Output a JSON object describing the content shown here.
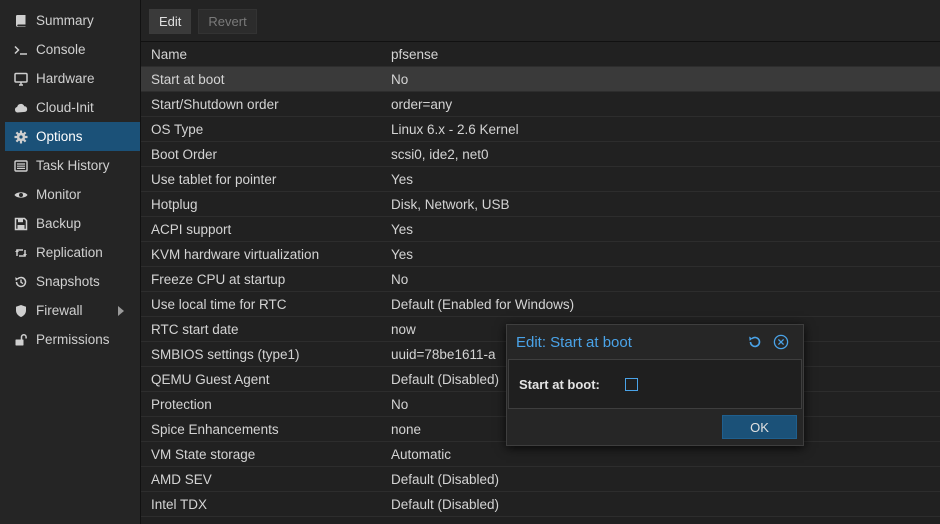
{
  "sidebar": {
    "items": [
      {
        "label": "Summary",
        "icon": "book-icon"
      },
      {
        "label": "Console",
        "icon": "terminal-icon"
      },
      {
        "label": "Hardware",
        "icon": "desktop-icon"
      },
      {
        "label": "Cloud-Init",
        "icon": "cloud-icon"
      },
      {
        "label": "Options",
        "icon": "gear-icon",
        "active": true
      },
      {
        "label": "Task History",
        "icon": "list-icon"
      },
      {
        "label": "Monitor",
        "icon": "eye-icon"
      },
      {
        "label": "Backup",
        "icon": "floppy-icon"
      },
      {
        "label": "Replication",
        "icon": "retweet-icon"
      },
      {
        "label": "Snapshots",
        "icon": "history-icon"
      },
      {
        "label": "Firewall",
        "icon": "shield-icon",
        "has_submenu": true
      },
      {
        "label": "Permissions",
        "icon": "unlock-icon"
      }
    ]
  },
  "toolbar": {
    "edit_label": "Edit",
    "revert_label": "Revert"
  },
  "options": {
    "rows": [
      {
        "name": "Name",
        "value": "pfsense"
      },
      {
        "name": "Start at boot",
        "value": "No",
        "selected": true
      },
      {
        "name": "Start/Shutdown order",
        "value": "order=any"
      },
      {
        "name": "OS Type",
        "value": "Linux 6.x - 2.6 Kernel"
      },
      {
        "name": "Boot Order",
        "value": "scsi0, ide2, net0"
      },
      {
        "name": "Use tablet for pointer",
        "value": "Yes"
      },
      {
        "name": "Hotplug",
        "value": "Disk, Network, USB"
      },
      {
        "name": "ACPI support",
        "value": "Yes"
      },
      {
        "name": "KVM hardware virtualization",
        "value": "Yes"
      },
      {
        "name": "Freeze CPU at startup",
        "value": "No"
      },
      {
        "name": "Use local time for RTC",
        "value": "Default (Enabled for Windows)"
      },
      {
        "name": "RTC start date",
        "value": "now"
      },
      {
        "name": "SMBIOS settings (type1)",
        "value": "uuid=78be1611-a"
      },
      {
        "name": "QEMU Guest Agent",
        "value": "Default (Disabled)"
      },
      {
        "name": "Protection",
        "value": "No"
      },
      {
        "name": "Spice Enhancements",
        "value": "none"
      },
      {
        "name": "VM State storage",
        "value": "Automatic"
      },
      {
        "name": "AMD SEV",
        "value": "Default (Disabled)"
      },
      {
        "name": "Intel TDX",
        "value": "Default (Disabled)"
      }
    ]
  },
  "dialog": {
    "title": "Edit: Start at boot",
    "field_label": "Start at boot:",
    "checked": false,
    "ok_label": "OK",
    "reset_icon": "undo-icon",
    "close_icon": "close-circle-icon"
  },
  "colors": {
    "accent": "#4aa3e8",
    "selected_nav": "#1b5178",
    "background": "#202020"
  }
}
